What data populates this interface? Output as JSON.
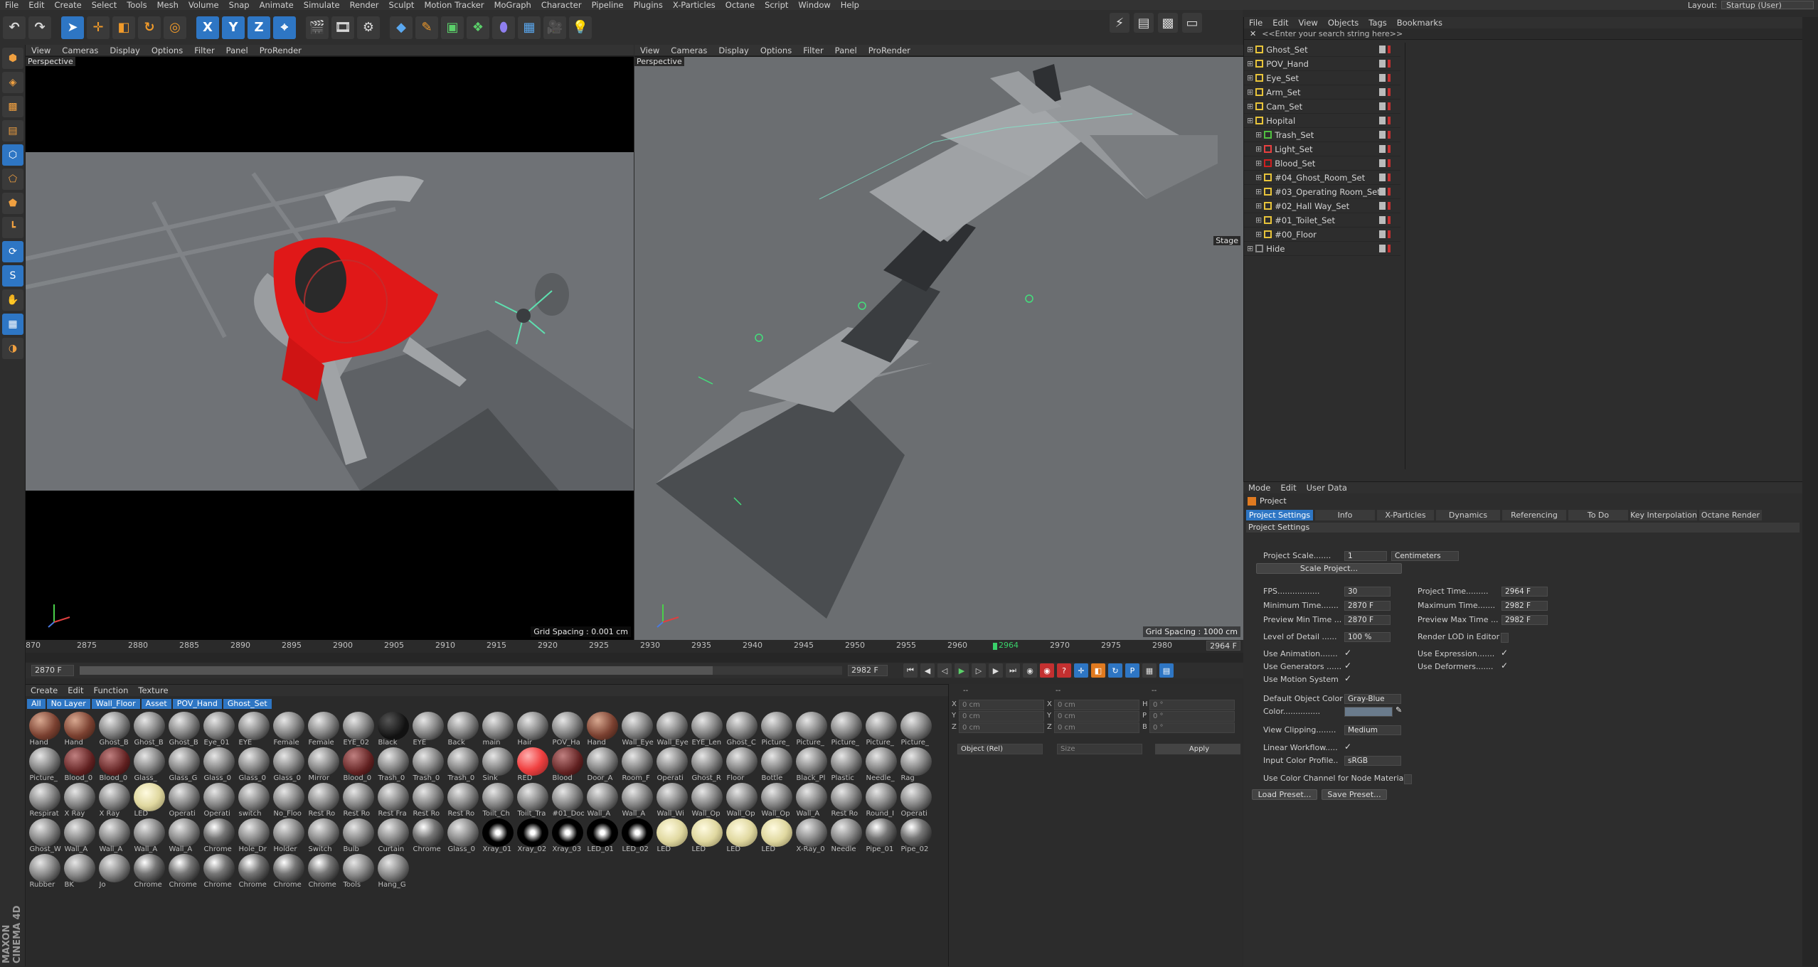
{
  "menu": [
    "File",
    "Edit",
    "Create",
    "Select",
    "Tools",
    "Mesh",
    "Volume",
    "Snap",
    "Animate",
    "Simulate",
    "Render",
    "Sculpt",
    "Motion Tracker",
    "MoGraph",
    "Character",
    "Pipeline",
    "Plugins",
    "X-Particles",
    "Octane",
    "Script",
    "Window",
    "Help"
  ],
  "layout": {
    "label": "Layout:",
    "value": "Startup (User)"
  },
  "toolbar_icons": [
    "undo-icon",
    "redo-icon",
    "select-arrow-icon",
    "move-icon",
    "scale-icon",
    "rotate-icon",
    "last-tool-icon",
    "x-axis-icon",
    "y-axis-icon",
    "z-axis-icon",
    "coord-system-icon",
    "render-view-icon",
    "render-picture-queue-icon",
    "render-settings-icon",
    "cube-icon",
    "pen-icon",
    "subdivision-icon",
    "cloner-icon",
    "deformer-icon",
    "floor-icon",
    "camera-icon",
    "light-icon"
  ],
  "axis_letters": [
    "X",
    "Y",
    "Z"
  ],
  "left_viewport": {
    "menu": [
      "View",
      "Cameras",
      "Display",
      "Options",
      "Filter",
      "Panel",
      "ProRender"
    ],
    "label": "Perspective",
    "grid": "Grid Spacing : 0.001 cm"
  },
  "right_viewport": {
    "menu": [
      "View",
      "Cameras",
      "Display",
      "Options",
      "Filter",
      "Panel",
      "ProRender"
    ],
    "label": "Perspective",
    "grid": "Grid Spacing : 1000 cm",
    "stage": "Stage"
  },
  "timeline": {
    "ticks": [
      "870",
      "2875",
      "2880",
      "2885",
      "2890",
      "2895",
      "2900",
      "2905",
      "2910",
      "2915",
      "2920",
      "2925",
      "2930",
      "2935",
      "2940",
      "2945",
      "2950",
      "2955",
      "2960",
      "2964",
      "2970",
      "2975",
      "2980"
    ],
    "current": "2964",
    "end_label": "2964 F"
  },
  "transport": {
    "start": "2870 F",
    "end": "2982 F",
    "progress": 0.83
  },
  "materials": {
    "menu": [
      "Create",
      "Edit",
      "Function",
      "Texture"
    ],
    "filters": [
      "All",
      "No Layer",
      "Wall_Floor",
      "Asset",
      "POV_Hand",
      "Ghost_Set"
    ],
    "items": [
      "Hand",
      "Hand",
      "Ghost_B",
      "Ghost_B",
      "Ghost_B",
      "Eye_01",
      "EYE",
      "Female",
      "Female",
      "EYE_02",
      "Black",
      "EYE",
      "Back",
      "main",
      "Hair",
      "POV_Ha",
      "Hand",
      "Wall_Eye",
      "Wall_Eye",
      "EYE_Len",
      "Ghost_C",
      "Picture_",
      "Picture_",
      "Picture_",
      "Picture_",
      "Picture_",
      "Picture_",
      "Blood_0",
      "Blood_0",
      "Glass_",
      "Glass_G",
      "Glass_0",
      "Glass_0",
      "Glass_0",
      "Mirror",
      "Blood_0",
      "Trash_0",
      "Trash_0",
      "Trash_0",
      "Sink",
      "RED",
      "Blood",
      "Door_A",
      "Room_F",
      "Operati",
      "Ghost_R",
      "Floor",
      "Bottle",
      "Black_Pl",
      "Plastic",
      "Needle_",
      "Rag",
      "Respirat",
      "X Ray",
      "X Ray",
      "LED",
      "Operati",
      "Operati",
      "switch",
      "No_Floo",
      "Rest Ro",
      "Rest Ro",
      "Rest Fra",
      "Rest Ro",
      "Rest Ro",
      "Toilt_Ch",
      "Toilt_Tra",
      "#01_Doo",
      "Wall_A",
      "Wall_A",
      "Wall_Wi",
      "Wall_Op",
      "Wall_Op",
      "Wall_Op",
      "Wall_A",
      "Rest Ro",
      "Round_I",
      "Operati",
      "Ghost_W",
      "Wall_A",
      "Wall_A",
      "Wall_A",
      "Wall_A",
      "Chrome",
      "Hole_Dr",
      "Holder",
      "Switch",
      "Bulb",
      "Curtain",
      "Chrome",
      "Glass_0",
      "Xray_01",
      "Xray_02",
      "Xray_03",
      "LED_01",
      "LED_02",
      "LED",
      "LED",
      "LED",
      "LED",
      "X-Ray_0",
      "Needle",
      "Pipe_01",
      "Pipe_02",
      "Rubber",
      "BK",
      "Jo",
      "Chrome",
      "Chrome",
      "Chrome",
      "Chrome",
      "Chrome",
      "Chrome",
      "Tools",
      "Hang_G"
    ]
  },
  "coords": {
    "rows": [
      {
        "a": "X",
        "v1": "0 cm",
        "b": "X",
        "v2": "0 cm",
        "c": "H",
        "v3": "0 °"
      },
      {
        "a": "Y",
        "v1": "0 cm",
        "b": "Y",
        "v2": "0 cm",
        "c": "P",
        "v3": "0 °"
      },
      {
        "a": "Z",
        "v1": "0 cm",
        "b": "Z",
        "v2": "0 cm",
        "c": "B",
        "v3": "0 °"
      }
    ],
    "mode": "Object (Rel)",
    "size": "Size",
    "apply": "Apply",
    "headers": [
      "--",
      "--",
      "--"
    ]
  },
  "objects": {
    "menu": [
      "File",
      "Edit",
      "View",
      "Objects",
      "Tags",
      "Bookmarks"
    ],
    "search": "<<Enter your search string here>>",
    "items": [
      {
        "name": "Ghost_Set",
        "indent": 0,
        "color": "#e8c43a"
      },
      {
        "name": "POV_Hand",
        "indent": 0,
        "color": "#e8c43a"
      },
      {
        "name": "Eye_Set",
        "indent": 0,
        "color": "#e8c43a"
      },
      {
        "name": "Arm_Set",
        "indent": 0,
        "color": "#e8c43a"
      },
      {
        "name": "Cam_Set",
        "indent": 0,
        "color": "#e8c43a"
      },
      {
        "name": "Hopital",
        "indent": 0,
        "color": "#e8c43a"
      },
      {
        "name": "Trash_Set",
        "indent": 1,
        "color": "#50c040"
      },
      {
        "name": "Light_Set",
        "indent": 1,
        "color": "#e84040"
      },
      {
        "name": "Blood_Set",
        "indent": 1,
        "color": "#d02020"
      },
      {
        "name": "#04_Ghost_Room_Set",
        "indent": 1,
        "color": "#e8c43a"
      },
      {
        "name": "#03_Operating Room_Set",
        "indent": 1,
        "color": "#e8c43a"
      },
      {
        "name": "#02_Hall Way_Set",
        "indent": 1,
        "color": "#e8c43a"
      },
      {
        "name": "#01_Toilet_Set",
        "indent": 1,
        "color": "#e8c43a"
      },
      {
        "name": "#00_Floor",
        "indent": 1,
        "color": "#e8c43a"
      },
      {
        "name": "Hide",
        "indent": 0,
        "color": "#888888"
      }
    ]
  },
  "attributes": {
    "menu": [
      "Mode",
      "Edit",
      "User Data"
    ],
    "title": "Project",
    "tabs": [
      "Project Settings",
      "Info",
      "X-Particles",
      "Dynamics",
      "Referencing",
      "To Do",
      "Key Interpolation",
      "Octane Render"
    ],
    "section": "Project Settings",
    "scale_label": "Project Scale.......",
    "scale_value": "1",
    "scale_unit": "Centimeters",
    "scale_btn": "Scale Project...",
    "fps_label": "FPS.................",
    "fps": "30",
    "project_time_label": "Project Time.........",
    "project_time": "2964 F",
    "min_time_label": "Minimum Time.......",
    "min_time": "2870 F",
    "max_time_label": "Maximum Time.......",
    "max_time": "2982 F",
    "prev_min_label": "Preview Min Time ...",
    "prev_min": "2870 F",
    "prev_max_label": "Preview Max Time ...",
    "prev_max": "2982 F",
    "lod_label": "Level of Detail ......",
    "lod": "100 %",
    "render_lod_label": "Render LOD in Editor",
    "use_anim": "Use Animation.......",
    "use_expr": "Use Expression.......",
    "use_gen": "Use Generators ......",
    "use_deform": "Use Deformers.......",
    "use_motion": "Use Motion System",
    "def_color_label": "Default Object Color",
    "def_color": "Gray-Blue",
    "color_label": "Color...............",
    "clip_label": "View Clipping........",
    "clip": "Medium",
    "linear_label": "Linear Workflow.....",
    "input_profile_label": "Input Color Profile..",
    "input_profile": "sRGB",
    "use_color_channel": "Use Color Channel for Node Material",
    "load_preset": "Load Preset...",
    "save_preset": "Save Preset...",
    "check": "✓"
  },
  "logo": "MAXON CINEMA 4D"
}
